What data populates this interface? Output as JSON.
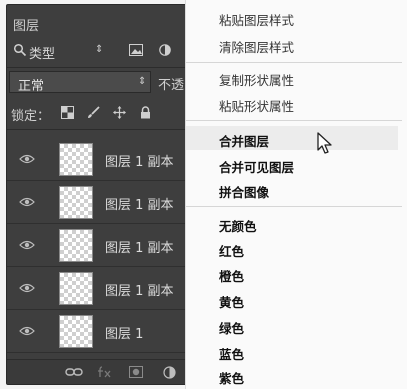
{
  "layers_panel": {
    "title": "图层",
    "filter": {
      "type_label": "类型",
      "spin": "⇕"
    },
    "blend_mode": {
      "label": "正常",
      "arrow": "⇕"
    },
    "opacity_label": "不透",
    "lock_label": "锁定：",
    "layers": [
      {
        "name": "图层 1 副本"
      },
      {
        "name": "图层 1 副本"
      },
      {
        "name": "图层 1 副本"
      },
      {
        "name": "图层 1 副本"
      },
      {
        "name": "图层 1"
      }
    ]
  },
  "context_menu": {
    "items": [
      {
        "label": "粘贴图层样式"
      },
      {
        "label": "清除图层样式"
      },
      {
        "label": "复制形状属性"
      },
      {
        "label": "粘贴形状属性"
      },
      {
        "label": "合并图层"
      },
      {
        "label": "合并可见图层"
      },
      {
        "label": "拼合图像"
      },
      {
        "label": "无颜色"
      },
      {
        "label": "红色"
      },
      {
        "label": "橙色"
      },
      {
        "label": "黄色"
      },
      {
        "label": "绿色"
      },
      {
        "label": "蓝色"
      },
      {
        "label": "紫色"
      }
    ]
  }
}
